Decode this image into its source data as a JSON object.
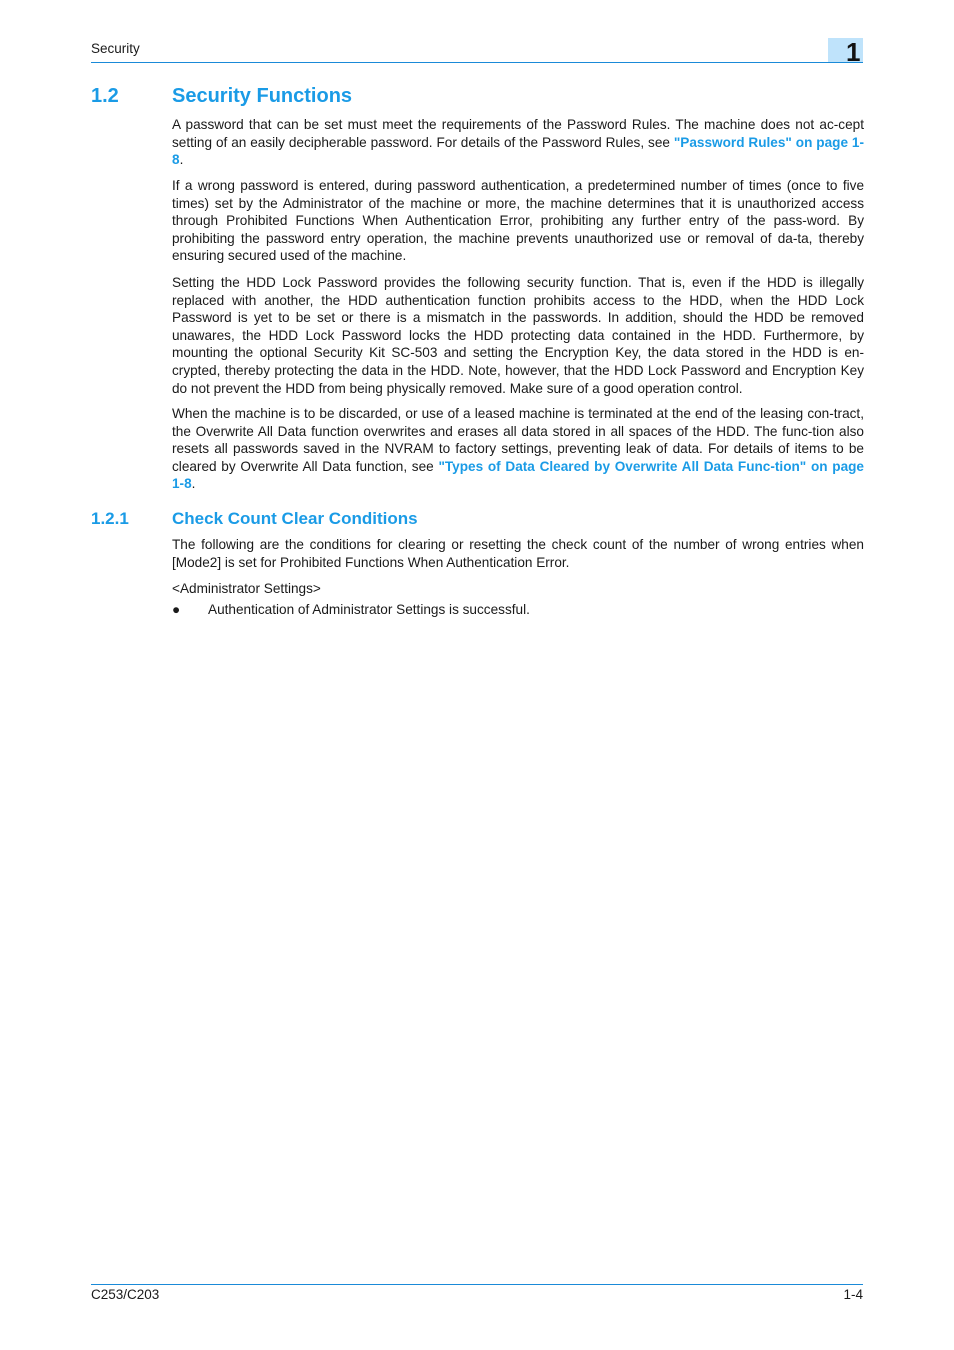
{
  "header": {
    "section_title": "Security",
    "chapter_number": "1"
  },
  "section": {
    "number": "1.2",
    "title": "Security Functions",
    "paragraphs": [
      {
        "text_before": "A password that can be set must meet the requirements of the Password Rules. The machine does not ac-cept setting of an easily decipherable password. For details of the Password Rules, see ",
        "link": "\"Password Rules\" on page 1-8",
        "text_after": "."
      },
      {
        "text": "If a wrong password is entered, during password authentication, a predetermined number of times (once to five times) set by the Administrator of the machine or more, the machine determines that it is unauthorized access through Prohibited Functions When Authentication Error, prohibiting any further entry of the pass-word. By prohibiting the password entry operation, the machine prevents unauthorized use or removal of da-ta, thereby ensuring secured used of the machine."
      },
      {
        "text": "Setting the HDD Lock Password provides the following security function. That is, even if the HDD is illegally replaced with another, the HDD authentication function prohibits access to the HDD, when the HDD Lock Password is yet to be set or there is a mismatch in the passwords. In addition, should the HDD be removed unawares, the HDD Lock Password locks the HDD protecting data contained in the HDD. Furthermore, by mounting the optional Security Kit SC-503 and setting the Encryption Key, the data stored in the HDD is en-crypted, thereby protecting the data in the HDD. Note, however, that the HDD Lock Password and Encryption Key do not prevent the HDD from being physically removed. Make sure of a good operation control."
      },
      {
        "text_before": "When the machine is to be discarded, or use of a leased machine is terminated at the end of the leasing con-tract, the Overwrite All Data function overwrites and erases all data stored in all spaces of the HDD. The func-tion also resets all passwords saved in the NVRAM to factory settings, preventing leak of data. For details of items to be cleared by Overwrite All Data function, see ",
        "link": "\"Types of Data Cleared by Overwrite All Data Func-tion\" on page 1-8",
        "text_after": "."
      }
    ]
  },
  "subsection": {
    "number": "1.2.1",
    "title": "Check Count Clear Conditions",
    "intro": "The following are the conditions for clearing or resetting the check count of the number of wrong entries when [Mode2] is set for Prohibited Functions When Authentication Error.",
    "group_label": "<Administrator Settings>",
    "bullets": [
      "Authentication of Administrator Settings is successful."
    ]
  },
  "footer": {
    "model": "C253/C203",
    "page": "1-4"
  },
  "colors": {
    "accent": "#1a9be6",
    "rule": "#1a8ad8",
    "chapter_tab": "#bfe3fb"
  }
}
